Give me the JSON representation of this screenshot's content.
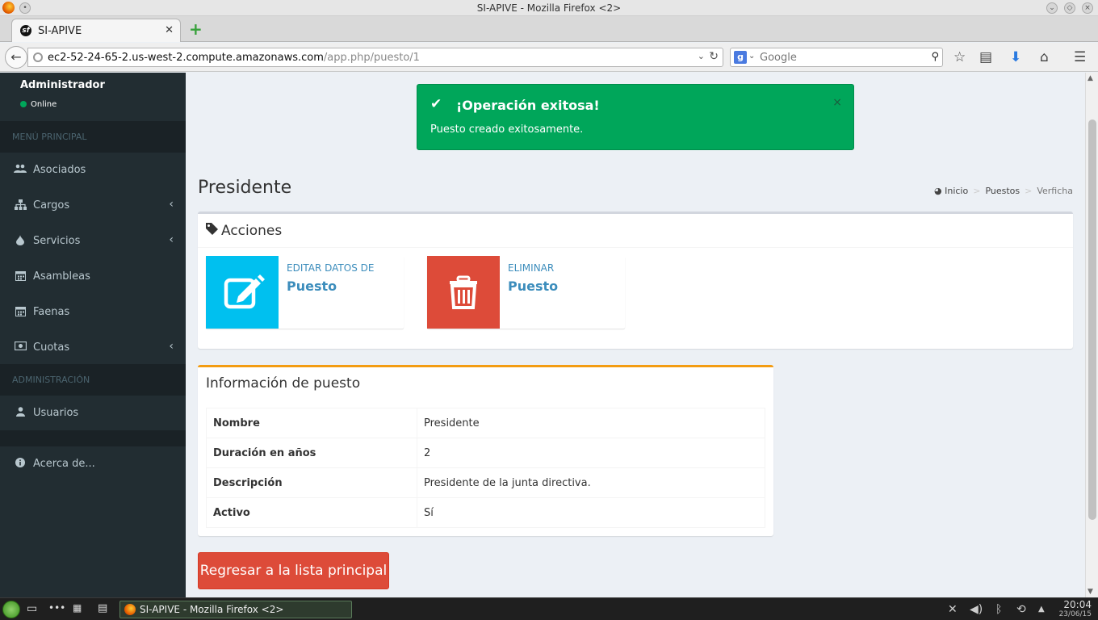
{
  "window": {
    "title": "SI-APIVE - Mozilla Firefox <2>"
  },
  "browser": {
    "tab_label": "SI-APIVE",
    "url_host": "ec2-52-24-65-2.us-west-2.compute.amazonaws.com",
    "url_path": "/app.php/puesto/1",
    "search_placeholder": "Google"
  },
  "sidebar": {
    "user_name": "Administrador",
    "user_status": "Online",
    "header_main": "MENÚ PRINCIPAL",
    "header_admin": "ADMINISTRACIÓN",
    "items": [
      {
        "label": "Asociados",
        "icon": "users-icon"
      },
      {
        "label": "Cargos",
        "icon": "sitemap-icon"
      },
      {
        "label": "Servicios",
        "icon": "tint-icon"
      },
      {
        "label": "Asambleas",
        "icon": "calendar-icon"
      },
      {
        "label": "Faenas",
        "icon": "calendar-icon"
      },
      {
        "label": "Cuotas",
        "icon": "money-icon"
      },
      {
        "label": "Usuarios",
        "icon": "user-icon"
      },
      {
        "label": "Acerca de...",
        "icon": "info-icon"
      }
    ]
  },
  "alert": {
    "title": "¡Operación exitosa!",
    "message": "Puesto creado exitosamente."
  },
  "page": {
    "title": "Presidente",
    "breadcrumb": [
      "Inicio",
      "Puestos",
      "Verficha"
    ]
  },
  "actions": {
    "title": "Acciones",
    "edit_text": "EDITAR DATOS DE",
    "edit_target": "Puesto",
    "delete_text": "ELIMINAR",
    "delete_target": "Puesto",
    "edit_color": "#00c0ef",
    "delete_color": "#dd4b39"
  },
  "info": {
    "title": "Información de puesto",
    "rows": [
      {
        "key": "Nombre",
        "value": "Presidente"
      },
      {
        "key": "Duración en años",
        "value": "2"
      },
      {
        "key": "Descripción",
        "value": "Presidente de la junta directiva."
      },
      {
        "key": "Activo",
        "value": "Sí"
      }
    ]
  },
  "back_button": "Regresar a la lista principal",
  "taskbar": {
    "task_label": "SI-APIVE - Mozilla Firefox <2>",
    "time": "20:04",
    "date": "23/06/15"
  }
}
